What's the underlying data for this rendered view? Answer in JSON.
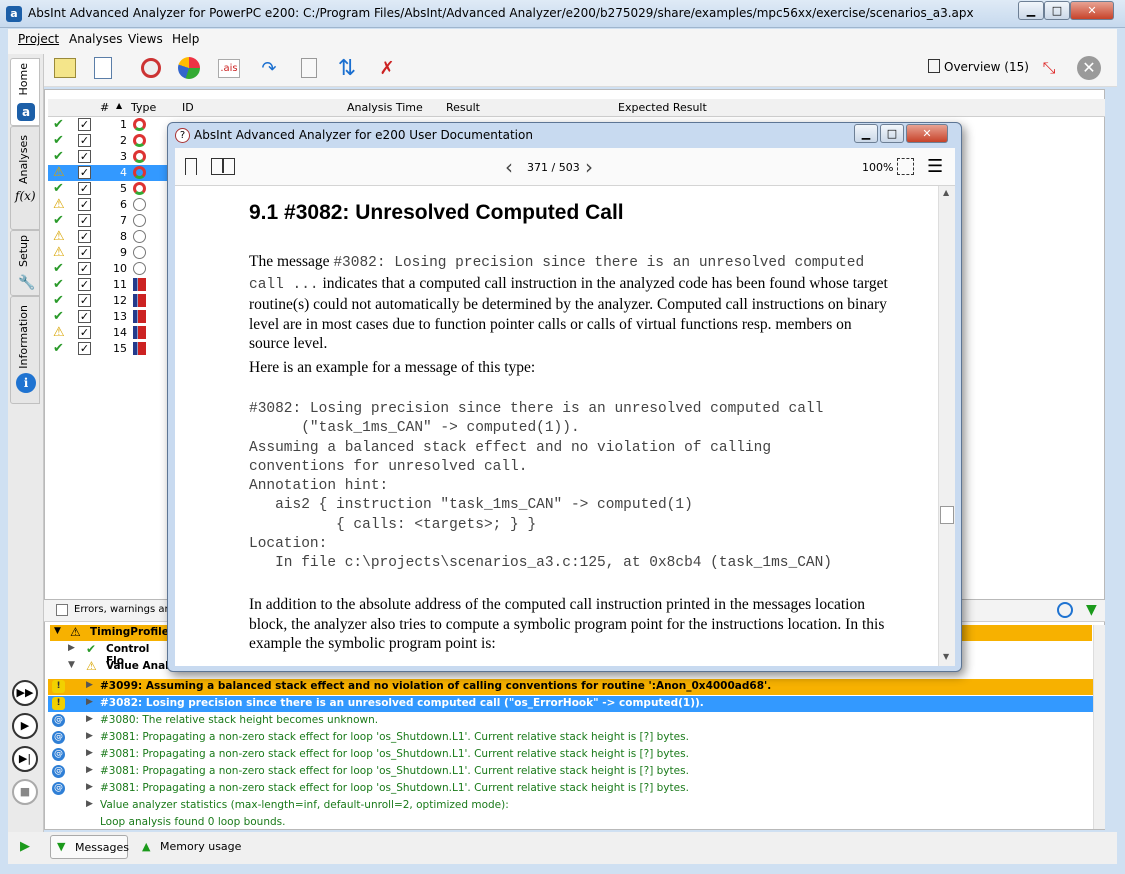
{
  "window": {
    "title": "AbsInt Advanced Analyzer for PowerPC e200: C:/Program Files/AbsInt/Advanced Analyzer/e200/b275029/share/examples/mpc56xx/exercise/scenarios_a3.apx",
    "minimize": "▁",
    "maximize": "□",
    "close": "✕"
  },
  "menu": [
    "Project",
    "Analyses",
    "Views",
    "Help"
  ],
  "toolbar": {
    "ais_label": ".ais",
    "overview": "Overview (15)"
  },
  "sidebar": {
    "home": "Home",
    "analyses": "Analyses",
    "fx": "f(x)",
    "setup": "Setup",
    "information": "Information"
  },
  "table": {
    "headers": {
      "num": "#",
      "type": "Type",
      "id": "ID",
      "time": "Analysis Time",
      "result": "Result",
      "expected": "Expected Result"
    },
    "rows": [
      {
        "n": "1",
        "status": "ok",
        "kind": "timing"
      },
      {
        "n": "2",
        "status": "ok",
        "kind": "timing"
      },
      {
        "n": "3",
        "status": "ok",
        "kind": "timing"
      },
      {
        "n": "4",
        "status": "warn",
        "kind": "timing"
      },
      {
        "n": "5",
        "status": "ok",
        "kind": "timing"
      },
      {
        "n": "6",
        "status": "warn",
        "kind": "stack"
      },
      {
        "n": "7",
        "status": "ok",
        "kind": "stack"
      },
      {
        "n": "8",
        "status": "warn",
        "kind": "stack"
      },
      {
        "n": "9",
        "status": "warn",
        "kind": "stack"
      },
      {
        "n": "10",
        "status": "ok",
        "kind": "stack"
      },
      {
        "n": "11",
        "status": "ok",
        "kind": "bar"
      },
      {
        "n": "12",
        "status": "ok",
        "kind": "bar"
      },
      {
        "n": "13",
        "status": "ok",
        "kind": "bar"
      },
      {
        "n": "14",
        "status": "warn",
        "kind": "bar"
      },
      {
        "n": "15",
        "status": "ok",
        "kind": "bar"
      }
    ]
  },
  "bottom": {
    "tab": "Errors, warnings and i",
    "tree": {
      "root": "TimingProfiler",
      "cf": "Control Flo",
      "va": "Value Anal"
    },
    "messages": [
      {
        "text": "#3099: Assuming a balanced stack effect and no violation of calling conventions for routine ':Anon_0x4000ad68'.",
        "style": "orange"
      },
      {
        "text": "#3082: Losing precision since there is an unresolved computed call (\"os_ErrorHook\" -> computed(1)).",
        "style": "blue"
      },
      {
        "text": "#3080: The relative stack height becomes unknown.",
        "style": "green"
      },
      {
        "text": "#3081: Propagating a non-zero stack effect for loop 'os_Shutdown.L1'. Current relative stack height is [?] bytes.",
        "style": "green"
      },
      {
        "text": "#3081: Propagating a non-zero stack effect for loop 'os_Shutdown.L1'. Current relative stack height is [?] bytes.",
        "style": "green"
      },
      {
        "text": "#3081: Propagating a non-zero stack effect for loop 'os_Shutdown.L1'. Current relative stack height is [?] bytes.",
        "style": "green"
      },
      {
        "text": "#3081: Propagating a non-zero stack effect for loop 'os_Shutdown.L1'. Current relative stack height is [?] bytes.",
        "style": "green"
      },
      {
        "text": "Value analyzer statistics (max-length=inf, default-unroll=2, optimized mode):",
        "style": "green"
      },
      {
        "text": "Loop analysis found 0 loop bounds.",
        "style": "green"
      }
    ]
  },
  "status": {
    "messages": "Messages",
    "memory": "Memory usage"
  },
  "doc": {
    "title": "AbsInt Advanced Analyzer for e200 User Documentation",
    "page": "371 / 503",
    "zoom": "100%",
    "heading": "9.1  #3082: Unresolved Computed Call",
    "p1_pre": "The message ",
    "p1_code": "#3082: Losing precision since there is an unresolved computed call ...",
    "p1_post": " indicates that a computed call instruction in the analyzed code has been found whose target routine(s) could not automatically be determined by the analyzer. Computed call instructions on binary level are in most cases due to function pointer calls or calls of virtual functions resp. members on source level.",
    "p2": "Here is an example for a message of this type:",
    "code": "#3082: Losing precision since there is an unresolved computed call\n      (\"task_1ms_CAN\" -> computed(1)).\nAssuming a balanced stack effect and no violation of calling\nconventions for unresolved call.\nAnnotation hint:\n   ais2 { instruction \"task_1ms_CAN\" -> computed(1)\n          { calls: <targets>; } }\nLocation:\n   In file c:\\projects\\scenarios_a3.c:125, at 0x8cb4 (task_1ms_CAN)",
    "p3": "In addition to the absolute address of the computed call instruction printed in the messages location block, the analyzer also tries to compute a symbolic program point for the instructions location. In this example the symbolic program point is:"
  }
}
